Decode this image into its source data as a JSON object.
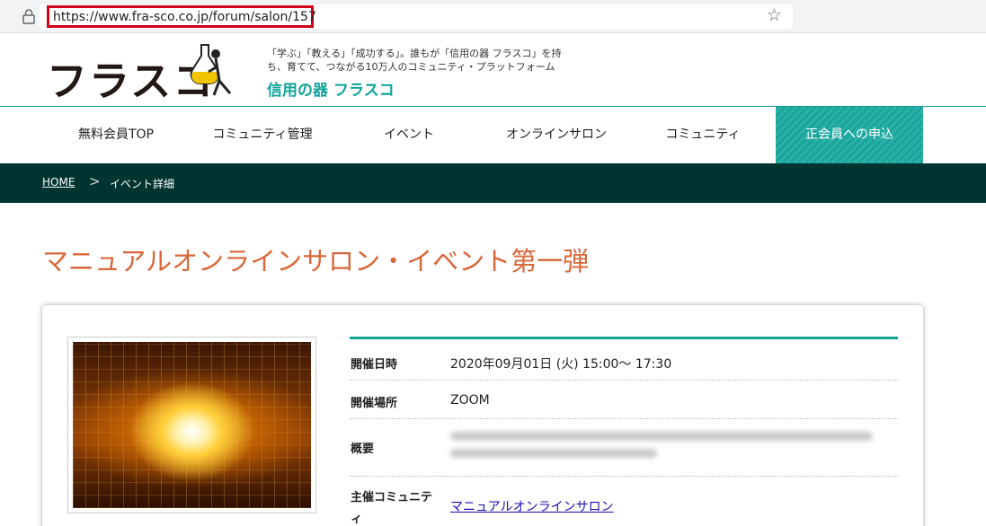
{
  "browser": {
    "url": "https://www.fra-sco.co.jp/forum/salon/157"
  },
  "header": {
    "logo_text": "フラスコ",
    "tagline_line1": "「学ぶ」「教える」「成功する」。誰もが「信用の器 フラスコ」を持",
    "tagline_line2": "ち、育てて、つながる10万人のコミュニティ・プラットフォーム",
    "brand_sub": "信用の器 フラスコ"
  },
  "nav": {
    "items": [
      {
        "label": "無料会員TOP"
      },
      {
        "label": "コミュニティ管理"
      },
      {
        "label": "イベント"
      },
      {
        "label": "オンラインサロン"
      },
      {
        "label": "コミュニティ"
      }
    ],
    "cta_label": "正会員への申込"
  },
  "breadcrumb": {
    "home": "HOME",
    "separator": ">",
    "current": "イベント詳細"
  },
  "page": {
    "title": "マニュアルオンラインサロン・イベント第一弾"
  },
  "event": {
    "rows": [
      {
        "label": "開催日時",
        "value": "2020年09月01日 (火) 15:00～ 17:30"
      },
      {
        "label": "開催場所",
        "value": "ZOOM"
      },
      {
        "label": "概要",
        "value": ""
      },
      {
        "label": "主催コミュニティ",
        "value": "マニュアルオンラインサロン"
      }
    ]
  },
  "colors": {
    "accent_teal": "#11a39a",
    "title_orange": "#d9673a",
    "crumb_bg": "#003430",
    "url_highlight": "#d0021b"
  }
}
